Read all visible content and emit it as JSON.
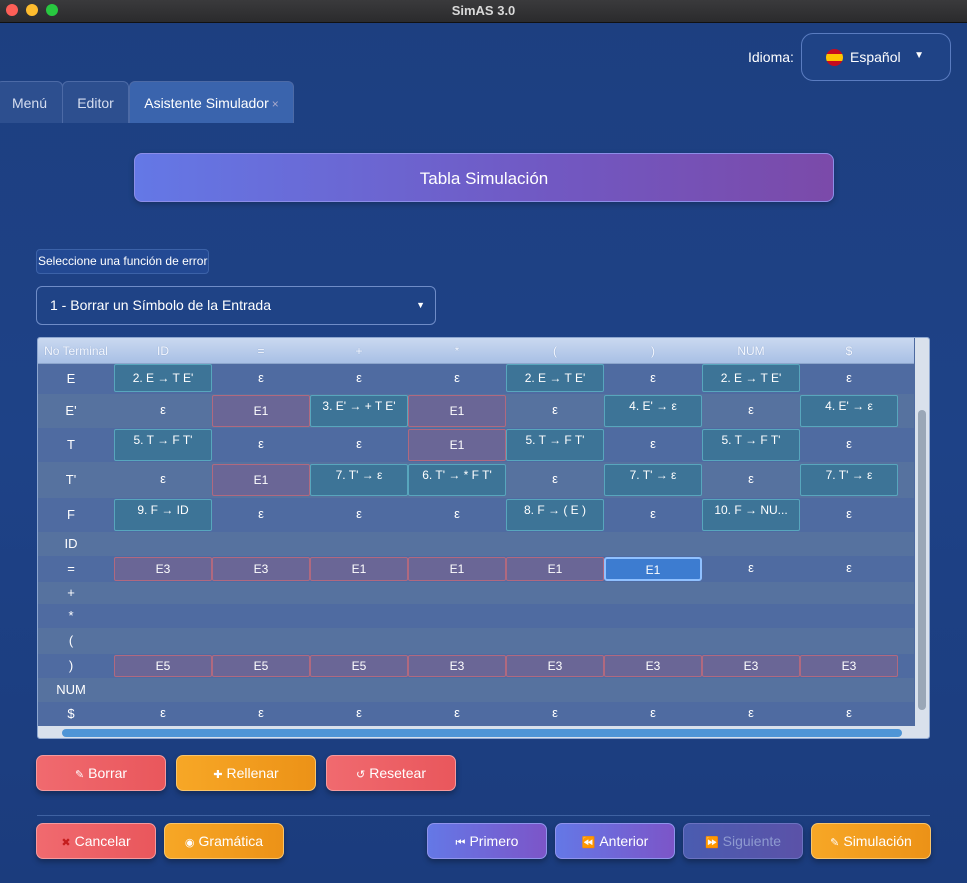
{
  "window": {
    "title": "SimAS 3.0"
  },
  "language": {
    "label": "Idioma:",
    "value": "Español",
    "flag_icon": "spain-flag-icon"
  },
  "tabs": [
    {
      "label": "Menú",
      "active": false
    },
    {
      "label": "Editor",
      "active": false
    },
    {
      "label": "Asistente Simulador",
      "active": true,
      "close": "×"
    }
  ],
  "banner": {
    "title": "Tabla Simulación"
  },
  "error_function": {
    "label": "Seleccione una función de error",
    "selected": "1 - Borrar un Símbolo de la Entrada"
  },
  "table": {
    "headers": [
      "No Terminal",
      "ID",
      "=",
      "+",
      "*",
      "(",
      ")",
      "NUM",
      "$"
    ],
    "rows": [
      {
        "nt": "E",
        "cells": [
          [
            "prod",
            "2. E → T E'"
          ],
          [
            "eps",
            "ε"
          ],
          [
            "eps",
            "ε"
          ],
          [
            "eps",
            "ε"
          ],
          [
            "prod",
            "2. E → T E'"
          ],
          [
            "eps",
            "ε"
          ],
          [
            "prod",
            "2. E → T E'"
          ],
          [
            "eps",
            "ε"
          ]
        ]
      },
      {
        "nt": "E'",
        "cells": [
          [
            "eps",
            "ε"
          ],
          [
            "err",
            "E1"
          ],
          [
            "prod",
            "3. E' → + T E'"
          ],
          [
            "err",
            "E1"
          ],
          [
            "eps",
            "ε"
          ],
          [
            "prod",
            "4. E' → ε"
          ],
          [
            "eps",
            "ε"
          ],
          [
            "prod",
            "4. E' → ε"
          ]
        ]
      },
      {
        "nt": "T",
        "cells": [
          [
            "prod",
            "5. T → F T'"
          ],
          [
            "eps",
            "ε"
          ],
          [
            "eps",
            "ε"
          ],
          [
            "err",
            "E1"
          ],
          [
            "prod",
            "5. T → F T'"
          ],
          [
            "eps",
            "ε"
          ],
          [
            "prod",
            "5. T → F T'"
          ],
          [
            "eps",
            "ε"
          ]
        ]
      },
      {
        "nt": "T'",
        "cells": [
          [
            "eps",
            "ε"
          ],
          [
            "err",
            "E1"
          ],
          [
            "prod",
            "7. T' → ε"
          ],
          [
            "prod",
            "6. T' → * F T'"
          ],
          [
            "eps",
            "ε"
          ],
          [
            "prod",
            "7. T' → ε"
          ],
          [
            "eps",
            "ε"
          ],
          [
            "prod",
            "7. T' → ε"
          ]
        ]
      },
      {
        "nt": "F",
        "cells": [
          [
            "prod",
            "9. F → ID"
          ],
          [
            "eps",
            "ε"
          ],
          [
            "eps",
            "ε"
          ],
          [
            "eps",
            "ε"
          ],
          [
            "prod",
            "8. F → ( E )"
          ],
          [
            "eps",
            "ε"
          ],
          [
            "prod",
            "10. F → NU..."
          ],
          [
            "eps",
            "ε"
          ]
        ]
      },
      {
        "nt": "ID",
        "cells": [
          [
            "none",
            ""
          ],
          [
            "none",
            ""
          ],
          [
            "none",
            ""
          ],
          [
            "none",
            ""
          ],
          [
            "none",
            ""
          ],
          [
            "none",
            ""
          ],
          [
            "none",
            ""
          ],
          [
            "none",
            ""
          ]
        ]
      },
      {
        "nt": "=",
        "cells": [
          [
            "err",
            "E3"
          ],
          [
            "err",
            "E3"
          ],
          [
            "err",
            "E1"
          ],
          [
            "err",
            "E1"
          ],
          [
            "err",
            "E1"
          ],
          [
            "sel",
            "E1"
          ],
          [
            "eps",
            "ε"
          ],
          [
            "eps",
            "ε"
          ]
        ]
      },
      {
        "nt": "+",
        "cells": [
          [
            "none",
            ""
          ],
          [
            "none",
            ""
          ],
          [
            "none",
            ""
          ],
          [
            "none",
            ""
          ],
          [
            "none",
            ""
          ],
          [
            "none",
            ""
          ],
          [
            "none",
            ""
          ],
          [
            "none",
            ""
          ]
        ]
      },
      {
        "nt": "*",
        "cells": [
          [
            "none",
            ""
          ],
          [
            "none",
            ""
          ],
          [
            "none",
            ""
          ],
          [
            "none",
            ""
          ],
          [
            "none",
            ""
          ],
          [
            "none",
            ""
          ],
          [
            "none",
            ""
          ],
          [
            "none",
            ""
          ]
        ]
      },
      {
        "nt": "(",
        "cells": [
          [
            "none",
            ""
          ],
          [
            "none",
            ""
          ],
          [
            "none",
            ""
          ],
          [
            "none",
            ""
          ],
          [
            "none",
            ""
          ],
          [
            "none",
            ""
          ],
          [
            "none",
            ""
          ],
          [
            "none",
            ""
          ]
        ]
      },
      {
        "nt": ")",
        "cells": [
          [
            "err",
            "E5"
          ],
          [
            "err",
            "E5"
          ],
          [
            "err",
            "E5"
          ],
          [
            "err",
            "E3"
          ],
          [
            "err",
            "E3"
          ],
          [
            "err",
            "E3"
          ],
          [
            "err",
            "E3"
          ],
          [
            "err",
            "E3"
          ]
        ]
      },
      {
        "nt": "NUM",
        "cells": [
          [
            "none",
            ""
          ],
          [
            "none",
            ""
          ],
          [
            "none",
            ""
          ],
          [
            "none",
            ""
          ],
          [
            "none",
            ""
          ],
          [
            "none",
            ""
          ],
          [
            "none",
            ""
          ],
          [
            "none",
            ""
          ]
        ]
      },
      {
        "nt": "$",
        "cells": [
          [
            "eps",
            "ε"
          ],
          [
            "eps",
            "ε"
          ],
          [
            "eps",
            "ε"
          ],
          [
            "eps",
            "ε"
          ],
          [
            "eps",
            "ε"
          ],
          [
            "eps",
            "ε"
          ],
          [
            "eps",
            "ε"
          ],
          [
            "eps",
            "ε"
          ]
        ]
      }
    ]
  },
  "actions": {
    "borrar": {
      "label": "Borrar",
      "icon": "eraser-icon"
    },
    "rellenar": {
      "label": "Rellenar",
      "icon": "fill-icon"
    },
    "resetear": {
      "label": "Resetear",
      "icon": "reset-icon"
    }
  },
  "footer": {
    "cancelar": {
      "label": "Cancelar",
      "icon": "cancel-icon"
    },
    "gramatica": {
      "label": "Gramática",
      "icon": "grammar-icon"
    },
    "primero": {
      "label": "Primero",
      "icon": "first-icon"
    },
    "anterior": {
      "label": "Anterior",
      "icon": "previous-icon"
    },
    "siguiente": {
      "label": "Siguiente",
      "icon": "next-icon",
      "enabled": false
    },
    "simulacion": {
      "label": "Simulación",
      "icon": "simulation-icon"
    }
  }
}
